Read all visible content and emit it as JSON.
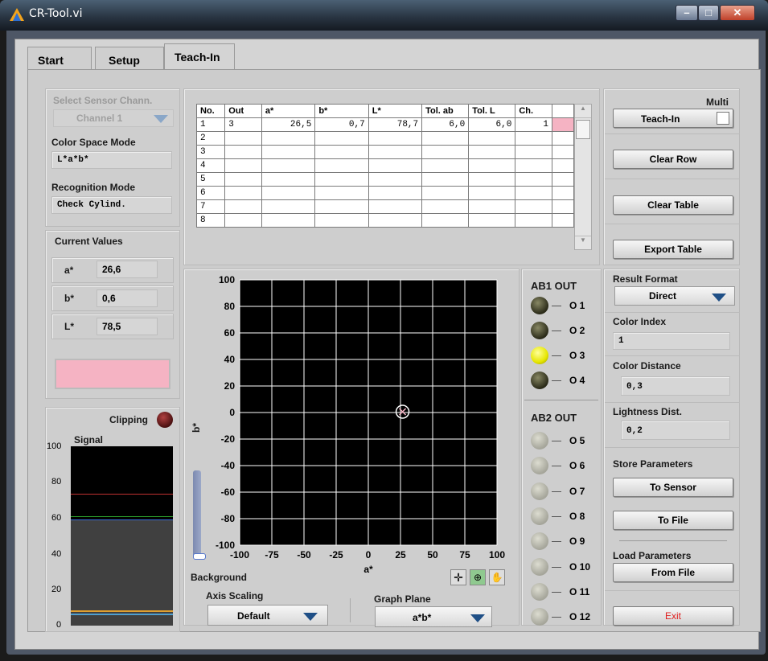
{
  "window": {
    "title": "CR-Tool.vi"
  },
  "tabs": [
    "Start",
    "Setup",
    "Teach-In"
  ],
  "left": {
    "select_sensor_label": "Select Sensor Chann.",
    "select_sensor_value": "Channel 1",
    "color_space_label": "Color Space Mode",
    "color_space_value": "L*a*b*",
    "recognition_label": "Recognition Mode",
    "recognition_value": "Check Cylind.",
    "current_values_label": "Current Values",
    "values": [
      {
        "name": "a*",
        "value": "26,6"
      },
      {
        "name": "b*",
        "value": "0,6"
      },
      {
        "name": "L*",
        "value": "78,5"
      }
    ],
    "swatch_color": "#f5b3c3",
    "clipping_label": "Clipping",
    "signal_label": "Signal",
    "signal_ticks": [
      "100",
      "80",
      "60",
      "40",
      "20",
      "0"
    ]
  },
  "table": {
    "headers": [
      "No.",
      "Out",
      "a*",
      "b*",
      "L*",
      "Tol. ab",
      "Tol. L",
      "Ch."
    ],
    "rows": [
      [
        "1",
        "3",
        "26,5",
        "0,7",
        "78,7",
        "6,0",
        "6,0",
        "1"
      ],
      [
        "2",
        "",
        "",
        "",
        "",
        "",
        "",
        ""
      ],
      [
        "3",
        "",
        "",
        "",
        "",
        "",
        "",
        ""
      ],
      [
        "4",
        "",
        "",
        "",
        "",
        "",
        "",
        ""
      ],
      [
        "5",
        "",
        "",
        "",
        "",
        "",
        "",
        ""
      ],
      [
        "6",
        "",
        "",
        "",
        "",
        "",
        "",
        ""
      ],
      [
        "7",
        "",
        "",
        "",
        "",
        "",
        "",
        ""
      ],
      [
        "8",
        "",
        "",
        "",
        "",
        "",
        "",
        ""
      ]
    ],
    "row1_color": "#f5b3c3"
  },
  "graph": {
    "y_label": "b*",
    "x_label": "a*",
    "y_ticks": [
      "100",
      "80",
      "60",
      "40",
      "20",
      "0",
      "-20",
      "-40",
      "-60",
      "-80",
      "-100"
    ],
    "x_ticks": [
      "-100",
      "-75",
      "-50",
      "-25",
      "0",
      "25",
      "50",
      "75",
      "100"
    ],
    "marker": {
      "a": 26.6,
      "b": 0.6
    },
    "background_label": "Background",
    "axis_scaling_label": "Axis Scaling",
    "axis_scaling_value": "Default",
    "graph_plane_label": "Graph Plane",
    "graph_plane_value": "a*b*"
  },
  "outputs": {
    "ab1_label": "AB1 OUT",
    "ab2_label": "AB2 OUT",
    "ab1": [
      {
        "label": "O 1",
        "state": "dark"
      },
      {
        "label": "O 2",
        "state": "dark"
      },
      {
        "label": "O 3",
        "state": "on"
      },
      {
        "label": "O 4",
        "state": "dark"
      }
    ],
    "ab2": [
      {
        "label": "O 5",
        "state": "off"
      },
      {
        "label": "O 6",
        "state": "off"
      },
      {
        "label": "O 7",
        "state": "off"
      },
      {
        "label": "O 8",
        "state": "off"
      },
      {
        "label": "O 9",
        "state": "off"
      },
      {
        "label": "O 10",
        "state": "off"
      },
      {
        "label": "O 11",
        "state": "off"
      },
      {
        "label": "O 12",
        "state": "off"
      }
    ]
  },
  "right": {
    "multi_label": "Multi",
    "teach_in_button": "Teach-In",
    "clear_row_button": "Clear Row",
    "clear_table_button": "Clear Table",
    "export_table_button": "Export Table",
    "result_format_label": "Result Format",
    "result_format_value": "Direct",
    "color_index_label": "Color Index",
    "color_index_value": "1",
    "color_distance_label": "Color Distance",
    "color_distance_value": "0,3",
    "lightness_label": "Lightness Dist.",
    "lightness_value": "0,2",
    "store_params_label": "Store Parameters",
    "to_sensor_button": "To Sensor",
    "to_file_button": "To File",
    "load_params_label": "Load Parameters",
    "from_file_button": "From File",
    "exit_button": "Exit",
    "exit_color": "#e02020"
  }
}
